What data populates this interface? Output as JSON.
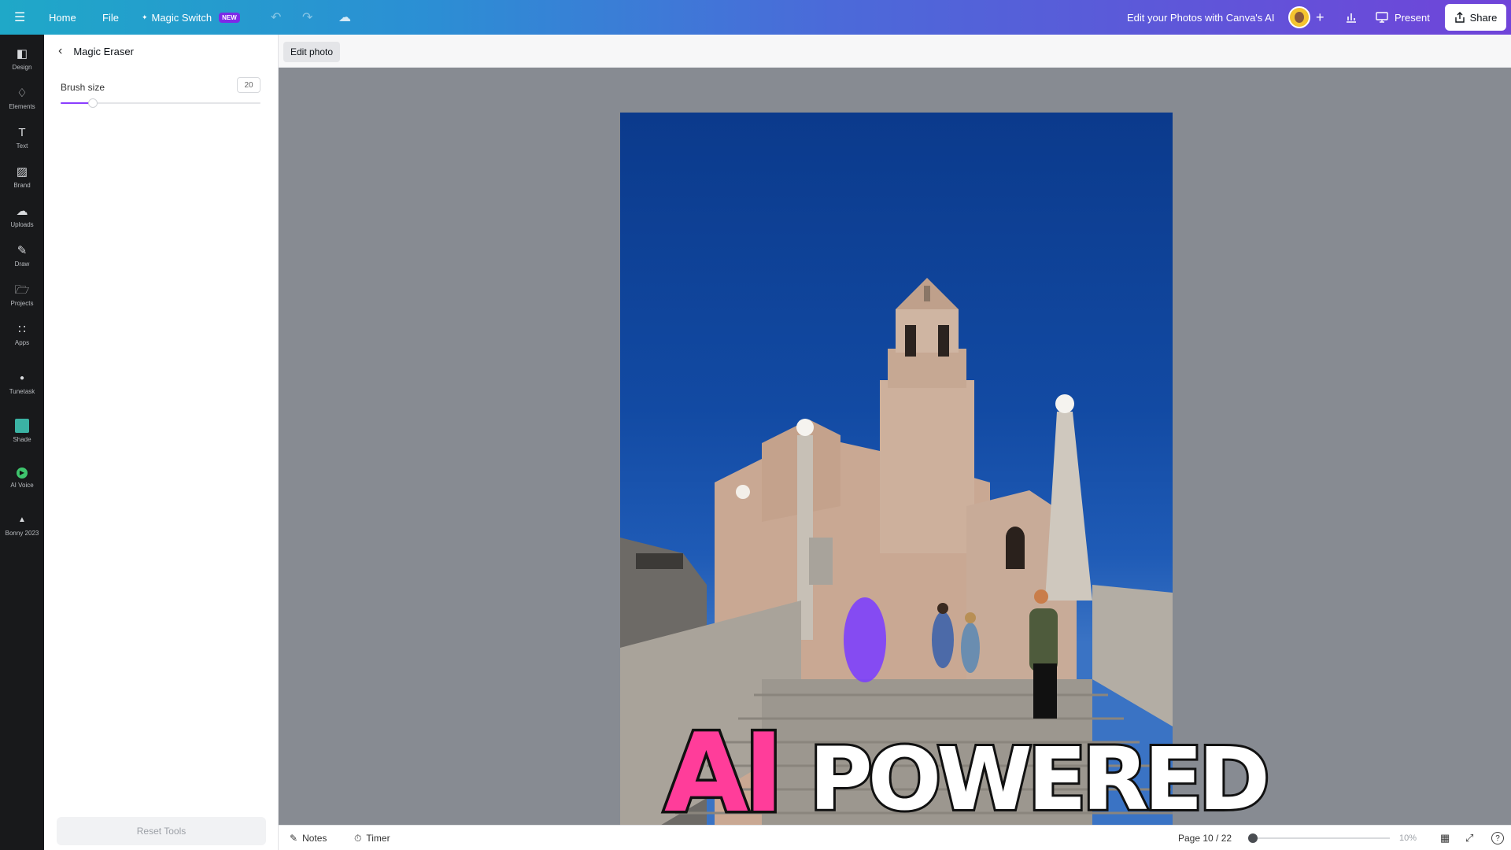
{
  "topbar": {
    "menu_icon": "hamburger-icon",
    "home": "Home",
    "file": "File",
    "magic_switch": "Magic Switch",
    "new_badge": "NEW",
    "title": "Edit your Photos with Canva's AI",
    "present": "Present",
    "share": "Share"
  },
  "rail": {
    "items": [
      {
        "label": "Design",
        "icon": "design-icon"
      },
      {
        "label": "Elements",
        "icon": "elements-icon"
      },
      {
        "label": "Text",
        "icon": "text-icon"
      },
      {
        "label": "Brand",
        "icon": "brand-icon"
      },
      {
        "label": "Uploads",
        "icon": "uploads-icon"
      },
      {
        "label": "Draw",
        "icon": "draw-icon"
      },
      {
        "label": "Projects",
        "icon": "projects-icon"
      },
      {
        "label": "Apps",
        "icon": "apps-icon"
      },
      {
        "label": "Tunetask",
        "icon": "tunetask-icon"
      },
      {
        "label": "Shade",
        "icon": "shade-icon"
      },
      {
        "label": "AI Voice",
        "icon": "ai-voice-icon"
      },
      {
        "label": "Bonny 2023",
        "icon": "bonny-icon"
      }
    ]
  },
  "panel": {
    "title": "Magic Eraser",
    "brush_label": "Brush size",
    "brush_value": "20",
    "brush_fraction": 0.16,
    "reset": "Reset Tools"
  },
  "canvas": {
    "edit_photo": "Edit photo",
    "headline_ai": "AI",
    "headline_powered": "POWERED"
  },
  "footer": {
    "notes": "Notes",
    "timer": "Timer",
    "page": "Page 10 / 22",
    "zoom": "10%",
    "zoom_fraction": 0.0
  },
  "colors": {
    "accent": "#8b3dff",
    "headline_pink": "#ff3d9a",
    "eraser_mark": "#7b3dff"
  }
}
